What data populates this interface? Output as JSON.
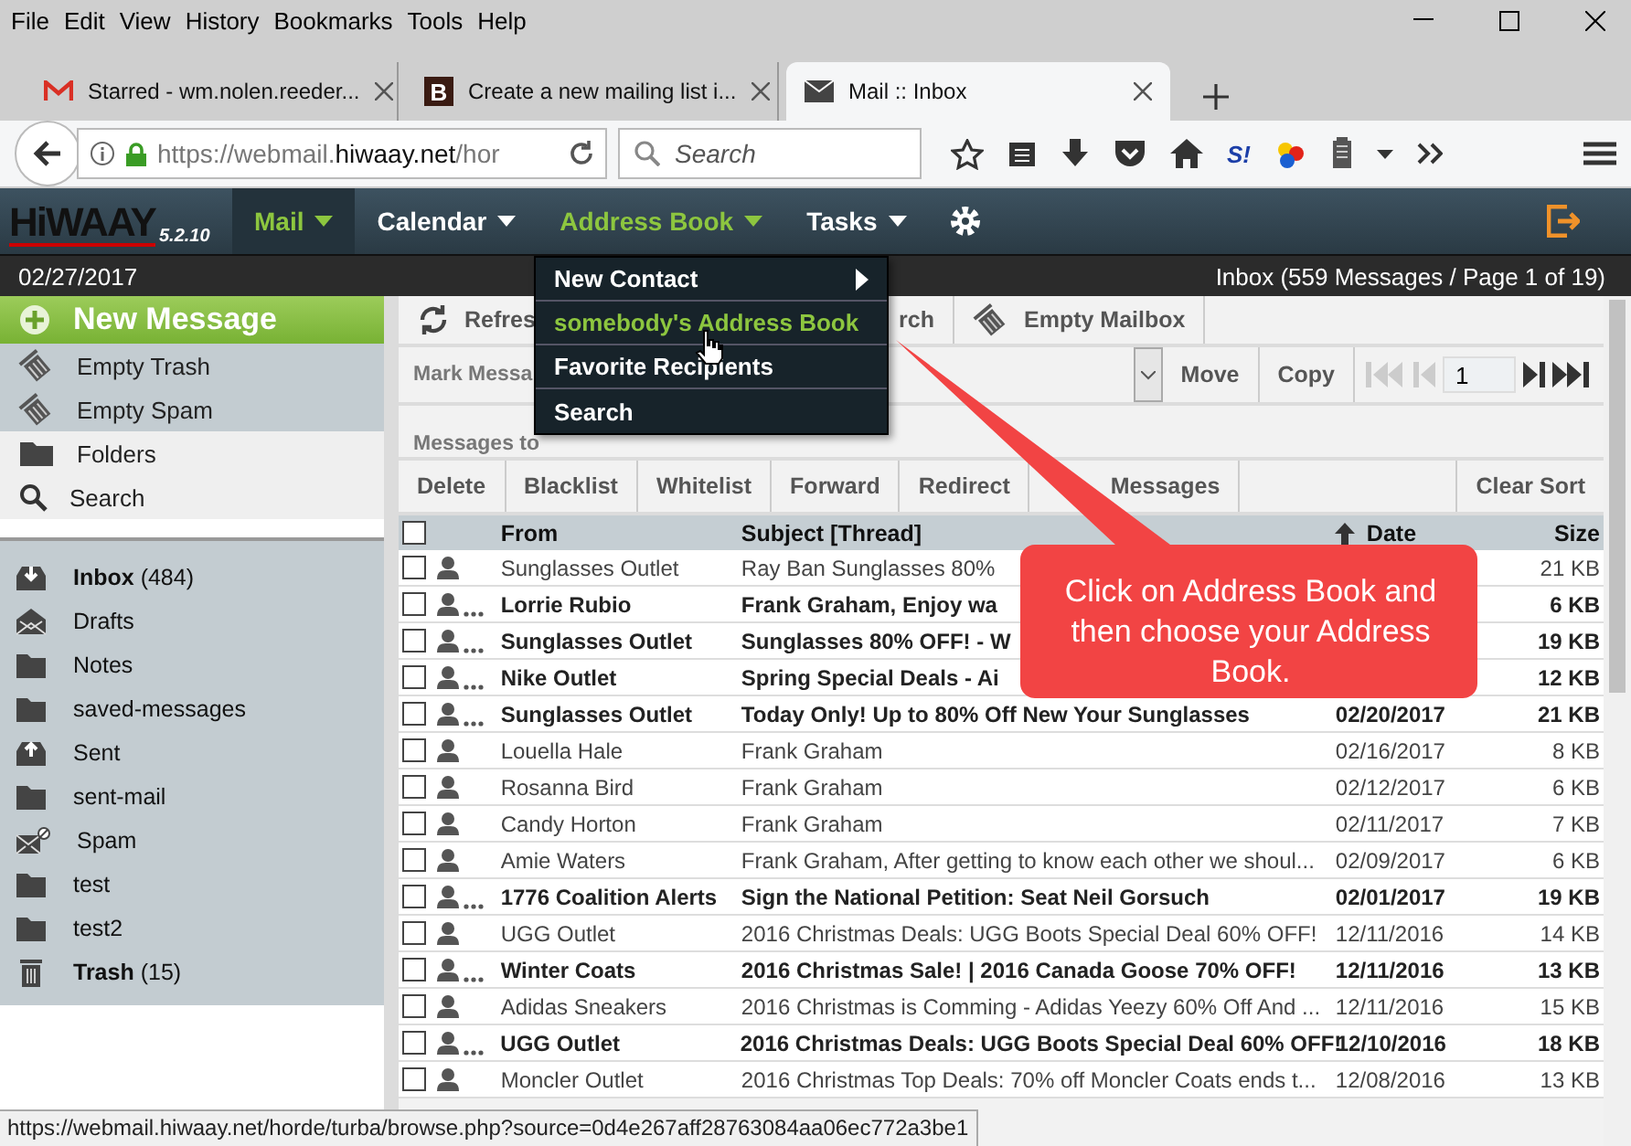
{
  "browser": {
    "menu": [
      "File",
      "Edit",
      "View",
      "History",
      "Bookmarks",
      "Tools",
      "Help"
    ],
    "tabs": [
      {
        "title": "Starred - wm.nolen.reeder...",
        "kind": "mail-m",
        "selected": false
      },
      {
        "title": "Create a new mailing list i...",
        "kind": "letter",
        "icon_text": "B",
        "selected": false
      },
      {
        "title": "Mail :: Inbox",
        "kind": "envelope",
        "selected": true
      }
    ],
    "url": [
      {
        "text": "https://webmail.",
        "emphasis": false
      },
      {
        "text": "hiwaay.net",
        "emphasis": true
      },
      {
        "text": "/hor",
        "emphasis": false
      }
    ],
    "search": {
      "placeholder": "Search"
    },
    "addon_label": "S!",
    "status_url": "https://webmail.hiwaay.net/horde/turba/browse.php?source=0d4e267aff28763084aa06ec772a3be1"
  },
  "app": {
    "logo": "HiWAAY",
    "version": "5.2.10",
    "nav": [
      {
        "label": "Mail",
        "selected": true,
        "open": false
      },
      {
        "label": "Calendar",
        "selected": false,
        "open": false
      },
      {
        "label": "Address Book",
        "selected": false,
        "open": true
      },
      {
        "label": "Tasks",
        "selected": false,
        "open": false
      }
    ],
    "date": "02/27/2017",
    "summary": "Inbox (559 Messages / Page 1 of 19)",
    "menu": [
      {
        "label": "New Contact",
        "submenu": true,
        "selected": false
      },
      {
        "label": "somebody's Address Book",
        "submenu": false,
        "selected": true
      },
      {
        "label": "Favorite Recipients",
        "submenu": false,
        "selected": false
      },
      {
        "label": "Search",
        "submenu": false,
        "selected": false
      }
    ],
    "sidebar": {
      "actions": [
        {
          "label": "New Message",
          "kind": "compose"
        },
        {
          "label": "Empty Trash",
          "kind": "empty"
        },
        {
          "label": "Empty Spam",
          "kind": "empty"
        },
        {
          "label": "Folders",
          "kind": "folders"
        },
        {
          "label": "Search",
          "kind": "search"
        }
      ],
      "folders": [
        {
          "label": "**Inbox** (484)",
          "kind": "inbox"
        },
        {
          "label": "Drafts",
          "kind": "drafts"
        },
        {
          "label": "Notes",
          "kind": "folder"
        },
        {
          "label": "saved-messages",
          "kind": "folder"
        },
        {
          "label": "Sent",
          "kind": "sent"
        },
        {
          "label": "sent-mail",
          "kind": "folder"
        },
        {
          "label": "Spam",
          "kind": "spam"
        },
        {
          "label": "test",
          "kind": "folder"
        },
        {
          "label": "test2",
          "kind": "folder"
        },
        {
          "label": "**Trash** (15)",
          "kind": "trash"
        }
      ]
    },
    "toolbar": [
      {
        "label": "Refres",
        "kind": "refresh"
      },
      {
        "label": "rch",
        "kind": "search"
      },
      {
        "label": "Empty Mailbox",
        "kind": "empty"
      }
    ],
    "mark_label": "Mark Messa",
    "move": "Move",
    "copy": "Copy",
    "page": "1",
    "target_label": "Messages to",
    "actions": [
      "Delete",
      "Blacklist",
      "Whitelist",
      "Forward",
      "Redirect",
      "Messages"
    ],
    "clear_sort": "Clear Sort",
    "select_all": {
      "checked": false
    },
    "columns": [
      "From",
      "Subject [Thread]",
      "Date",
      "Size"
    ],
    "rows": [
      {
        "from": "Sunglasses Outlet",
        "subject": "Ray Ban Sunglasses 80%",
        "size": "21 KB",
        "unread": false,
        "checked": false
      },
      {
        "from": "Lorrie Rubio",
        "subject": "Frank Graham, Enjoy wa",
        "size": "6 KB",
        "unread": true,
        "checked": false
      },
      {
        "from": "Sunglasses Outlet",
        "subject": "Sunglasses 80% OFF! - W",
        "size": "19 KB",
        "unread": true,
        "checked": false
      },
      {
        "from": "Nike Outlet",
        "subject": "Spring Special Deals - Ai",
        "size": "12 KB",
        "unread": true,
        "checked": false
      },
      {
        "from": "Sunglasses Outlet",
        "subject": "Today Only! Up to 80% Off New Your Sunglasses",
        "date": "02/20/2017",
        "size": "21 KB",
        "unread": true,
        "checked": false
      },
      {
        "from": "Louella Hale",
        "subject": "Frank Graham",
        "date": "02/16/2017",
        "size": "8 KB",
        "unread": false,
        "checked": false
      },
      {
        "from": "Rosanna Bird",
        "subject": "Frank Graham",
        "date": "02/12/2017",
        "size": "6 KB",
        "unread": false,
        "checked": false
      },
      {
        "from": "Candy Horton",
        "subject": "Frank Graham",
        "date": "02/11/2017",
        "size": "7 KB",
        "unread": false,
        "checked": false
      },
      {
        "from": "Amie Waters",
        "subject": "Frank Graham, After getting to know each other we shoul...",
        "date": "02/09/2017",
        "size": "6 KB",
        "unread": false,
        "checked": false
      },
      {
        "from": "1776 Coalition Alerts",
        "subject": "Sign the National Petition: Seat Neil Gorsuch",
        "date": "02/01/2017",
        "size": "19 KB",
        "unread": true,
        "checked": false
      },
      {
        "from": "UGG Outlet",
        "subject": "2016 Christmas Deals: UGG Boots Special Deal 60% OFF!",
        "date": "12/11/2016",
        "size": "14 KB",
        "unread": false,
        "checked": false
      },
      {
        "from": "Winter Coats",
        "subject": "2016 Christmas Sale! | 2016 Canada Goose 70% OFF!",
        "date": "12/11/2016",
        "size": "13 KB",
        "unread": true,
        "checked": false
      },
      {
        "from": "Adidas Sneakers",
        "subject": "2016 Christmas is Comming - Adidas Yeezy 60% Off And ...",
        "date": "12/11/2016",
        "size": "15 KB",
        "unread": false,
        "checked": false
      },
      {
        "from": "UGG Outlet",
        "subject": "2016 Christmas Deals: UGG Boots Special Deal 60% OFF!",
        "date": "12/10/2016",
        "size": "18 KB",
        "unread": true,
        "checked": false
      },
      {
        "from": "Moncler Outlet",
        "subject": "2016 Christmas Top Deals: 70% off Moncler Coats ends t...",
        "date": "12/08/2016",
        "size": "13 KB",
        "unread": false,
        "checked": false
      }
    ]
  },
  "callout": "Click on Address Book and then choose your Address Book."
}
